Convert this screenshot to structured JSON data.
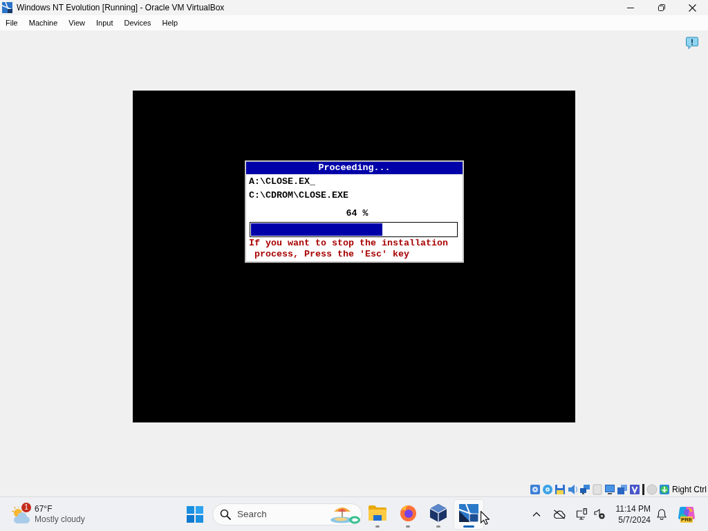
{
  "window": {
    "title": "Windows NT Evolution [Running] - Oracle VM VirtualBox"
  },
  "menu": [
    "File",
    "Machine",
    "View",
    "Input",
    "Devices",
    "Help"
  ],
  "vm_screen": {
    "dialog": {
      "title": "Proceeding...",
      "source": "A:\\CLOSE.EX_",
      "destination": "C:\\CDROM\\CLOSE.EXE",
      "percent": "64 %",
      "progress": {
        "level": 0.64
      },
      "message": "If you want to stop the installation process, Press the 'Esc' key"
    }
  },
  "status_bar": {
    "host_key": "Right Ctrl"
  },
  "taskbar": {
    "weather": {
      "badge": "1",
      "temperature": "67°F",
      "condition": "Mostly cloudy"
    },
    "search": {
      "placeholder": "Search"
    },
    "apps": [
      {
        "kind": "folder",
        "selected": false
      },
      {
        "kind": "globe",
        "selected": false
      },
      {
        "kind": "cube",
        "selected": false
      },
      {
        "kind": "tile",
        "selected": true
      }
    ],
    "tray": {
      "assistant_badge": "PRE"
    },
    "clock": {
      "time": "11:14 PM",
      "date": "5/7/2024"
    }
  }
}
